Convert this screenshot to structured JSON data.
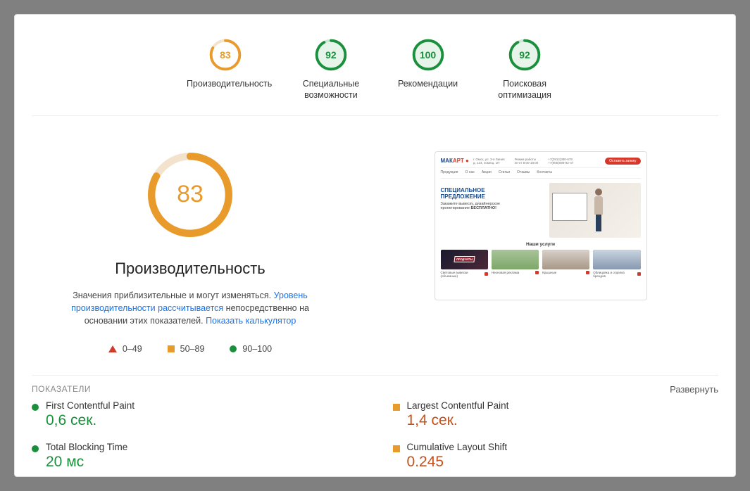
{
  "gauges": [
    {
      "score": "83",
      "label": "Производительность",
      "color": "#e89b2a",
      "bg": "#fff",
      "pct": 83
    },
    {
      "score": "92",
      "label": "Специальные возможности",
      "color": "#1a8f3c",
      "bg": "#e6f4ea",
      "pct": 92
    },
    {
      "score": "100",
      "label": "Рекомендации",
      "color": "#1a8f3c",
      "bg": "#e6f4ea",
      "pct": 100
    },
    {
      "score": "92",
      "label": "Поисковая оптимизация",
      "color": "#1a8f3c",
      "bg": "#e6f4ea",
      "pct": 92
    }
  ],
  "performance": {
    "score": "83",
    "title": "Производительность",
    "desc_a": "Значения приблизительные и могут изменяться. ",
    "link_a": "Уровень производительности рассчитывается",
    "desc_b": " непосредственно на основании этих показателей. ",
    "link_b": "Показать калькулятор"
  },
  "legend": {
    "r1": "0–49",
    "r2": "50–89",
    "r3": "90–100"
  },
  "thumbnail": {
    "logo_a": "МАК",
    "logo_b": "АРТ",
    "cta": "Оставить заявку",
    "nav": [
      "Продукция",
      "О нас",
      "Акции",
      "Статьи",
      "Отзывы",
      "Контакты"
    ],
    "hero_h1_a": "СПЕЦИАЛЬНОЕ",
    "hero_h1_b": "ПРЕДЛОЖЕНИЕ",
    "hero_sub_a": "Закажите вывеску, дизайнерское",
    "hero_sub_b": "проектирование",
    "hero_bold": " БЕСПЛАТНО!",
    "section": "Наши услуги",
    "card_sign": "ПРОДУКТЫ",
    "caps": [
      "Световые вывески (объемные)",
      "Неоновая реклама",
      "Крышные",
      "Облицовка и отделка брендов"
    ]
  },
  "metrics_title": "ПОКАЗАТЕЛИ",
  "expand_label": "Развернуть",
  "metrics": [
    {
      "name": "First Contentful Paint",
      "value": "0,6 сек.",
      "status": "green"
    },
    {
      "name": "Largest Contentful Paint",
      "value": "1,4 сек.",
      "status": "orange"
    },
    {
      "name": "Total Blocking Time",
      "value": "20 мс",
      "status": "green"
    },
    {
      "name": "Cumulative Layout Shift",
      "value": "0.245",
      "status": "orange"
    }
  ]
}
